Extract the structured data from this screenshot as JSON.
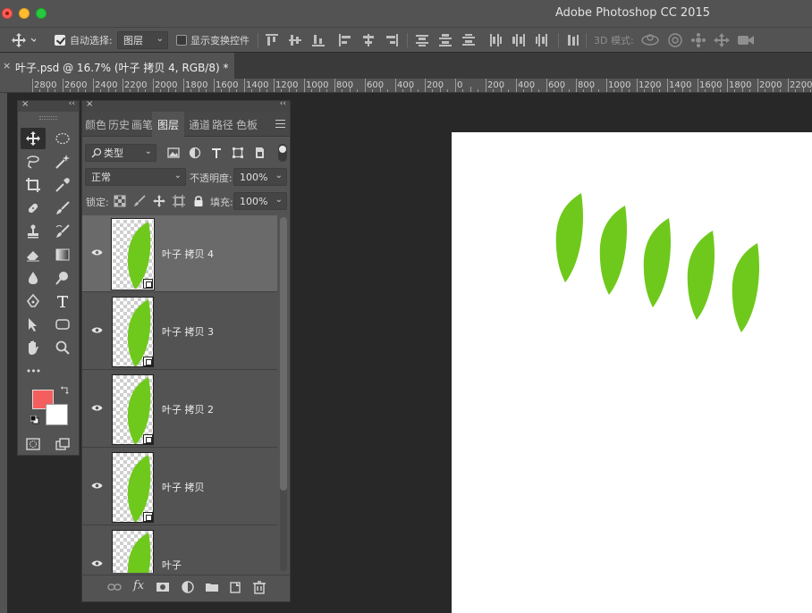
{
  "window": {
    "app_title": "Adobe Photoshop CC 2015"
  },
  "options_bar": {
    "auto_select_label": "自动选择:",
    "auto_select_checked": true,
    "auto_select_target": "图层",
    "show_transform_label": "显示变换控件",
    "show_transform_checked": false,
    "mode_3d_label": "3D 模式:"
  },
  "document_tab": {
    "close_glyph": "×",
    "title": "叶子.psd @ 16.7% (叶子 拷贝 4, RGB/8) *"
  },
  "ruler": {
    "labels": [
      "2800",
      "2600",
      "2400",
      "2200",
      "2000",
      "1800",
      "1600",
      "1400",
      "1200",
      "1000",
      "800",
      "600",
      "400",
      "200",
      "0",
      "200",
      "400",
      "600",
      "800",
      "1000",
      "1200",
      "1400",
      "1600",
      "1800",
      "2000",
      "2200"
    ]
  },
  "tools_panel": {
    "close_glyph": "×",
    "collapse_glyph": "‹‹",
    "foreground_color": "#f45e5e",
    "background_color": "#ffffff",
    "more_glyph": "•••"
  },
  "layers_panel": {
    "close_glyph": "×",
    "collapse_glyph": "‹‹",
    "tabs": [
      {
        "label": "颜色",
        "active": false
      },
      {
        "label": "历史",
        "active": false
      },
      {
        "label": "画笔",
        "active": false
      },
      {
        "label": "图层",
        "active": true
      },
      {
        "label": "通道",
        "active": false
      },
      {
        "label": "路径",
        "active": false
      },
      {
        "label": "色板",
        "active": false
      }
    ],
    "filter_kind": "类型",
    "blend_mode": "正常",
    "opacity_label": "不透明度:",
    "opacity_value": "100%",
    "lock_label": "锁定:",
    "fill_label": "填充:",
    "fill_value": "100%",
    "layers": [
      {
        "name": "叶子 拷贝 4",
        "selected": true,
        "visible": true
      },
      {
        "name": "叶子 拷贝 3",
        "selected": false,
        "visible": true
      },
      {
        "name": "叶子 拷贝 2",
        "selected": false,
        "visible": true
      },
      {
        "name": "叶子 拷贝",
        "selected": false,
        "visible": true
      },
      {
        "name": "叶子",
        "selected": false,
        "visible": true
      }
    ],
    "footer_fx_label": "fx"
  },
  "canvas": {
    "background": "#ffffff",
    "leaf_color": "#6fc91c",
    "leaf_count": 5
  }
}
